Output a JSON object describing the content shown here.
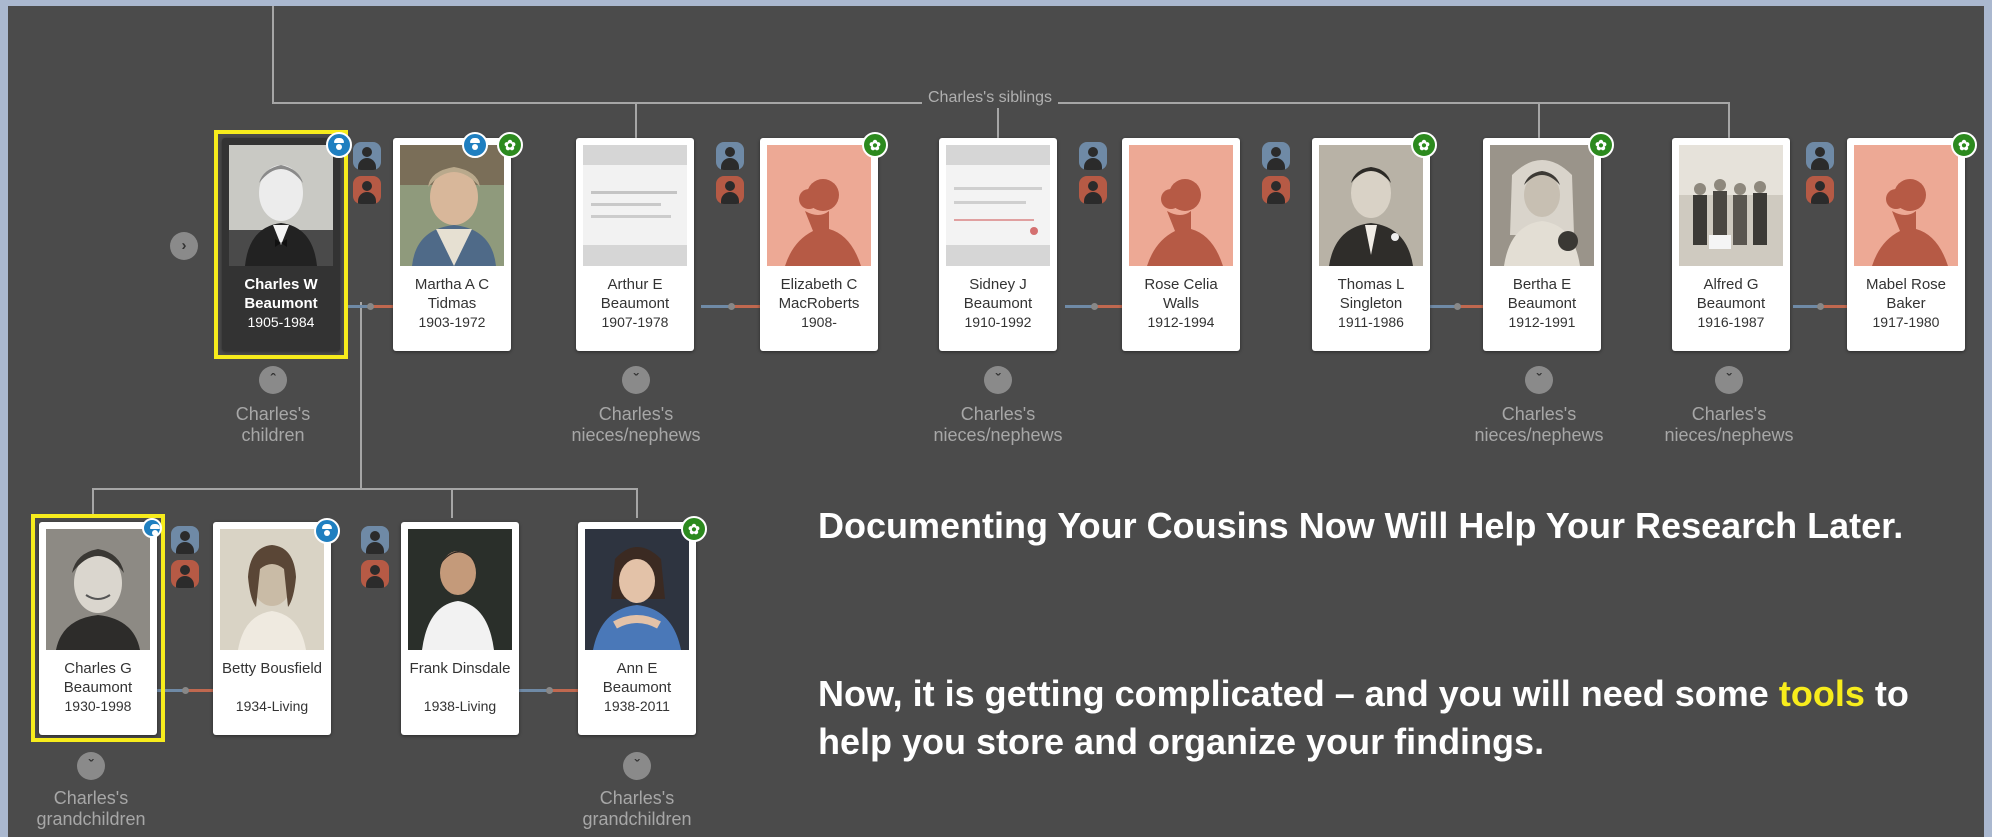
{
  "siblings_label": "Charles's siblings",
  "people": [
    {
      "key": "charles_w",
      "name": "Charles W Beaumont",
      "dates": "1905-1984"
    },
    {
      "key": "martha",
      "name": "Martha A C Tidmas",
      "dates": "1903-1972"
    },
    {
      "key": "arthur",
      "name": "Arthur E Beaumont",
      "dates": "1907-1978"
    },
    {
      "key": "elizabeth",
      "name": "Elizabeth C MacRoberts",
      "dates": "1908-"
    },
    {
      "key": "sidney",
      "name": "Sidney J Beaumont",
      "dates": "1910-1992"
    },
    {
      "key": "rose",
      "name": "Rose Celia Walls",
      "dates": "1912-1994"
    },
    {
      "key": "thomas",
      "name": "Thomas L Singleton",
      "dates": "1911-1986"
    },
    {
      "key": "bertha",
      "name": "Bertha E Beaumont",
      "dates": "1912-1991"
    },
    {
      "key": "alfred",
      "name": "Alfred G Beaumont",
      "dates": "1916-1987"
    },
    {
      "key": "mabel",
      "name": "Mabel Rose Baker",
      "dates": "1917-1980"
    },
    {
      "key": "charles_g",
      "name": "Charles G Beaumont",
      "dates": "1930-1998"
    },
    {
      "key": "betty",
      "name": "Betty Bousfield",
      "dates": "1934-Living"
    },
    {
      "key": "frank",
      "name": "Frank Dinsdale",
      "dates": "1938-Living"
    },
    {
      "key": "ann",
      "name": "Ann E Beaumont",
      "dates": "1938-2011"
    }
  ],
  "relation_labels": {
    "children": "Charles's children",
    "nieces_nephews": "Charles's nieces/nephews",
    "grandchildren": "Charles's grandchildren"
  },
  "message": {
    "line1": "Documenting Your Cousins Now Will Help Your Research Later.",
    "line2_pre": "Now, it is getting complicated – and you will need some",
    "line2_highlight": "tools",
    "line2_post": "to help you store and organize your findings."
  },
  "icons": {
    "hint": "leaf-hint-icon",
    "photo_badge": "person-badge-icon",
    "expand": "chevron-down-icon",
    "collapse": "chevron-up-icon",
    "navigate": "chevron-right-icon"
  },
  "colors": {
    "background": "#4b4b4b",
    "highlight": "#f7ec1c",
    "hint_leaf": "#2c8a1e",
    "badge": "#1f7fc0",
    "father_line": "#6f8aa6",
    "mother_line": "#c0684f"
  }
}
